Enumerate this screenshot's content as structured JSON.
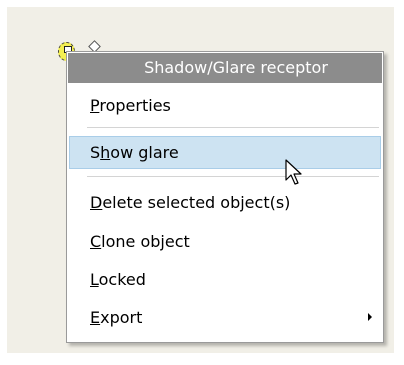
{
  "context_menu": {
    "title": "Shadow/Glare receptor",
    "items": [
      {
        "mnemonic": "P",
        "rest": "roperties"
      },
      {
        "before": "S",
        "mnemonic": "h",
        "rest": "ow glare"
      },
      {
        "mnemonic": "D",
        "rest": "elete selected object(s)"
      },
      {
        "mnemonic": "C",
        "rest": "lone object"
      },
      {
        "mnemonic": "L",
        "rest": "ocked"
      },
      {
        "mnemonic": "E",
        "rest": "xport"
      }
    ],
    "highlighted_item": "Show glare"
  },
  "colors": {
    "title_bar": "#8c8c8c",
    "highlight": "#cde3f2",
    "canvas_bg": "#f1efe7",
    "marker_fill": "#f4ef52"
  },
  "icons": {
    "object_marker": "receptor-marker-icon",
    "handle": "diamond-handle-icon",
    "submenu": "submenu-arrow-icon",
    "cursor": "mouse-pointer-icon"
  }
}
